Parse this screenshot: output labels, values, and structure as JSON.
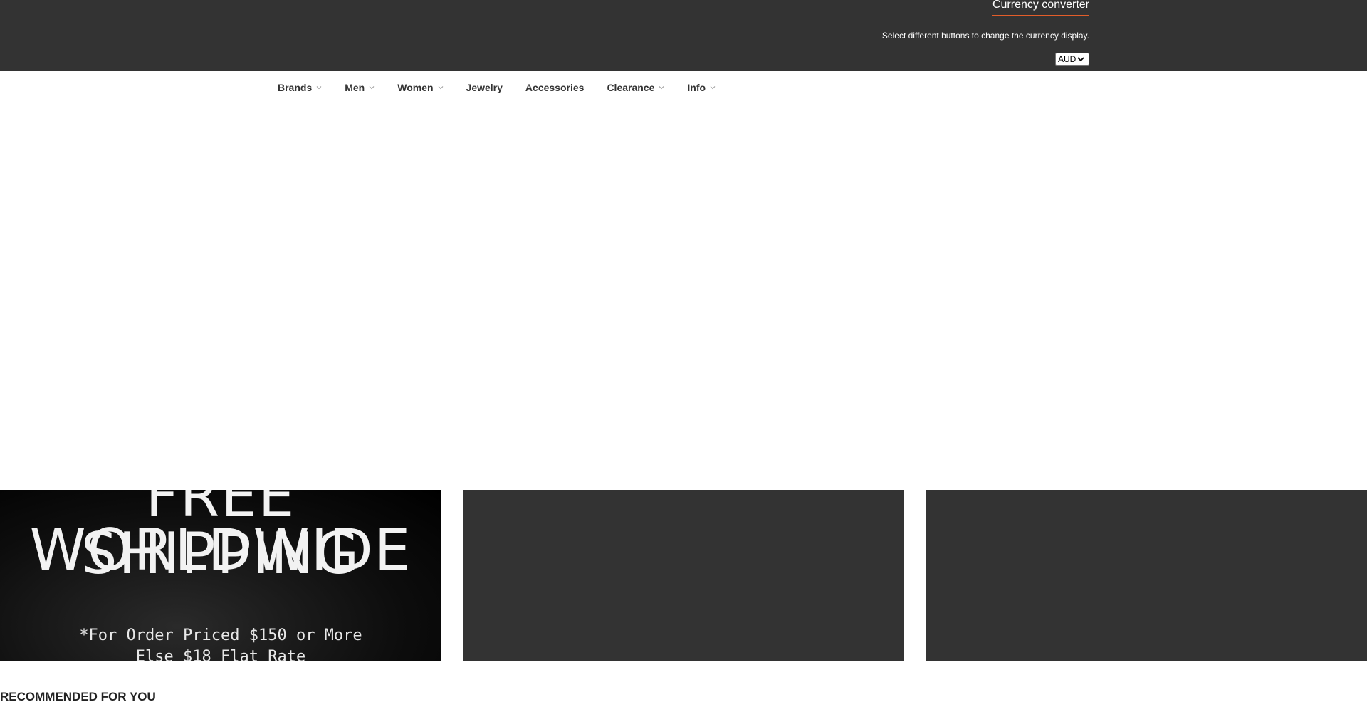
{
  "currency": {
    "tab_label": "Currency converter",
    "hint": "Select different buttons to change the currency display.",
    "selected": "AUD",
    "accent_color": "#e35d2a"
  },
  "nav": {
    "items": [
      {
        "label": "Brands",
        "has_dropdown": true
      },
      {
        "label": "Men",
        "has_dropdown": true
      },
      {
        "label": "Women",
        "has_dropdown": true
      },
      {
        "label": "Jewelry",
        "has_dropdown": false
      },
      {
        "label": "Accessories",
        "has_dropdown": false
      },
      {
        "label": "Clearance",
        "has_dropdown": true
      },
      {
        "label": "Info",
        "has_dropdown": true
      }
    ]
  },
  "banners": {
    "shipping": {
      "line1": "FREE SHIPPING",
      "line2": "WORLDWIDE",
      "note1": "*For Order Priced $150 or More",
      "note2": "Else $18 Flat Rate"
    }
  },
  "sections": {
    "recommended_title": "RECOMMENDED FOR YOU"
  }
}
